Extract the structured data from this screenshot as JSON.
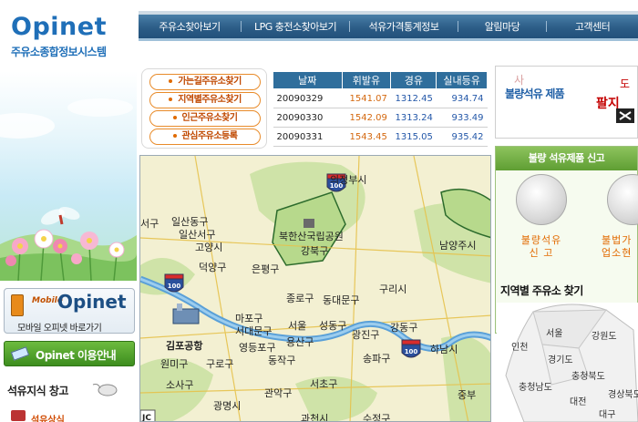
{
  "brand": {
    "name": "Opinet",
    "subtitle": "주유소종합정보시스템"
  },
  "nav": {
    "items": [
      {
        "label": "주유소찾아보기"
      },
      {
        "label": "LPG 충전소찾아보기"
      },
      {
        "label": "석유가격통계정보"
      },
      {
        "label": "알림마당"
      },
      {
        "label": "고객센터"
      }
    ]
  },
  "quick_links": [
    {
      "label": "가는길주유소찾기"
    },
    {
      "label": "지역별주유소찾기"
    },
    {
      "label": "인근주유소찾기"
    },
    {
      "label": "관심주유소등록"
    }
  ],
  "price_table": {
    "headers": [
      "날짜",
      "휘발유",
      "경유",
      "실내등유"
    ],
    "rows": [
      {
        "date": "20090329",
        "gasoline": "1541.07",
        "diesel": "1312.45",
        "kerosene": "934.74"
      },
      {
        "date": "20090330",
        "gasoline": "1542.09",
        "diesel": "1313.24",
        "kerosene": "933.49"
      },
      {
        "date": "20090331",
        "gasoline": "1543.45",
        "diesel": "1315.05",
        "kerosene": "935.42"
      }
    ]
  },
  "left_panel": {
    "mobile_tag": "Mobile",
    "mobile_title": "Opinet",
    "mobile_sub": "모바일 오피넷 바로가기",
    "guide_label": "Opinet 이용안내",
    "knowledge_title": "석유지식 창고",
    "oil_link": "석유상식"
  },
  "map": {
    "labels": [
      {
        "text": "의정부시"
      },
      {
        "text": "일산동구"
      },
      {
        "text": "서구"
      },
      {
        "text": "일산서구"
      },
      {
        "text": "덕양구"
      },
      {
        "text": "고양시"
      },
      {
        "text": "북한산국립공원"
      },
      {
        "text": "강북구"
      },
      {
        "text": "은평구"
      },
      {
        "text": "남양주시"
      },
      {
        "text": "종로구"
      },
      {
        "text": "동대문구"
      },
      {
        "text": "구리시"
      },
      {
        "text": "마포구"
      },
      {
        "text": "서대문구"
      },
      {
        "text": "서울"
      },
      {
        "text": "성동구"
      },
      {
        "text": "광진구"
      },
      {
        "text": "용산구"
      },
      {
        "text": "강동구"
      },
      {
        "text": "김포공항"
      },
      {
        "text": "영등포구"
      },
      {
        "text": "원미구"
      },
      {
        "text": "구로구"
      },
      {
        "text": "동작구"
      },
      {
        "text": "송파구"
      },
      {
        "text": "하남시"
      },
      {
        "text": "소사구"
      },
      {
        "text": "관악구"
      },
      {
        "text": "서초구"
      },
      {
        "text": "광명시"
      },
      {
        "text": "중부"
      },
      {
        "text": "과천시"
      },
      {
        "text": "수정구"
      }
    ],
    "shields": [
      "100",
      "100",
      "100"
    ],
    "scale_badge": "JC"
  },
  "right_panel": {
    "banner_title": "불량석유 제품",
    "banner_a": "사",
    "banner_b": "팔지",
    "banner_c": "도",
    "report_title": "불량 석유제품 신고",
    "report_left": [
      "불량석유",
      "신  고"
    ],
    "report_right": [
      "불법가",
      "업소현"
    ],
    "region_title": "지역별 주유소 찾기",
    "regions": [
      "서울",
      "인천",
      "강원도",
      "경기도",
      "충청북도",
      "충청남도",
      "대전",
      "경상북도",
      "대구"
    ]
  }
}
